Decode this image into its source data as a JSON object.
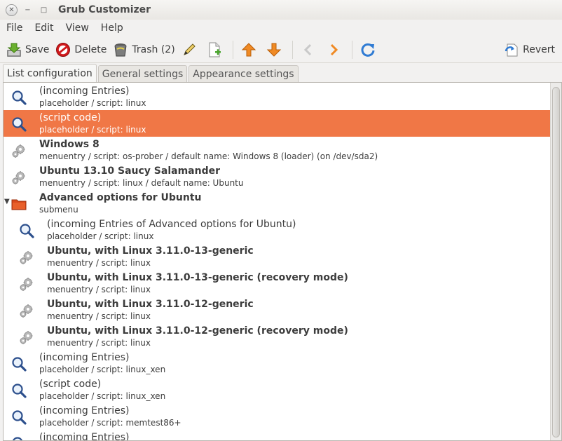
{
  "window": {
    "title": "Grub Customizer"
  },
  "menubar": [
    "File",
    "Edit",
    "View",
    "Help"
  ],
  "toolbar": {
    "save": "Save",
    "delete": "Delete",
    "trash": "Trash (2)",
    "revert": "Revert"
  },
  "tabs": [
    "List configuration",
    "General settings",
    "Appearance settings"
  ],
  "entries": [
    {
      "title": "(incoming Entries)",
      "subtitle": "placeholder / script: linux",
      "icon": "search-icon",
      "bold": false,
      "indent": 0,
      "selected": false
    },
    {
      "title": "(script code)",
      "subtitle": "placeholder / script: linux",
      "icon": "search-icon",
      "bold": false,
      "indent": 0,
      "selected": true
    },
    {
      "title": "Windows 8",
      "subtitle": "menuentry / script: os-prober / default name: Windows 8 (loader) (on /dev/sda2)",
      "icon": "gear-icon",
      "bold": true,
      "indent": 0,
      "selected": false
    },
    {
      "title": "Ubuntu 13.10 Saucy Salamander",
      "subtitle": "menuentry / script: linux / default name: Ubuntu",
      "icon": "gear-icon",
      "bold": true,
      "indent": 0,
      "selected": false
    },
    {
      "title": "Advanced options for Ubuntu",
      "subtitle": "submenu",
      "icon": "folder-icon",
      "bold": true,
      "indent": 0,
      "selected": false,
      "expanded": true
    },
    {
      "title": "(incoming Entries of Advanced options for Ubuntu)",
      "subtitle": "placeholder / script: linux",
      "icon": "search-icon",
      "bold": false,
      "indent": 1,
      "selected": false
    },
    {
      "title": "Ubuntu, with Linux 3.11.0-13-generic",
      "subtitle": "menuentry / script: linux",
      "icon": "gear-icon",
      "bold": true,
      "indent": 1,
      "selected": false
    },
    {
      "title": "Ubuntu, with Linux 3.11.0-13-generic (recovery mode)",
      "subtitle": "menuentry / script: linux",
      "icon": "gear-icon",
      "bold": true,
      "indent": 1,
      "selected": false
    },
    {
      "title": "Ubuntu, with Linux 3.11.0-12-generic",
      "subtitle": "menuentry / script: linux",
      "icon": "gear-icon",
      "bold": true,
      "indent": 1,
      "selected": false
    },
    {
      "title": "Ubuntu, with Linux 3.11.0-12-generic (recovery mode)",
      "subtitle": "menuentry / script: linux",
      "icon": "gear-icon",
      "bold": true,
      "indent": 1,
      "selected": false
    },
    {
      "title": "(incoming Entries)",
      "subtitle": "placeholder / script: linux_xen",
      "icon": "search-icon",
      "bold": false,
      "indent": 0,
      "selected": false
    },
    {
      "title": "(script code)",
      "subtitle": "placeholder / script: linux_xen",
      "icon": "search-icon",
      "bold": false,
      "indent": 0,
      "selected": false
    },
    {
      "title": "(incoming Entries)",
      "subtitle": "placeholder / script: memtest86+",
      "icon": "search-icon",
      "bold": false,
      "indent": 0,
      "selected": false
    },
    {
      "title": "(incoming Entries)",
      "subtitle": "",
      "icon": "search-icon",
      "bold": false,
      "indent": 0,
      "selected": false
    }
  ],
  "colors": {
    "selection": "#f07746",
    "accent_orange": "#f08a24",
    "refresh_blue": "#2f7bd3"
  }
}
